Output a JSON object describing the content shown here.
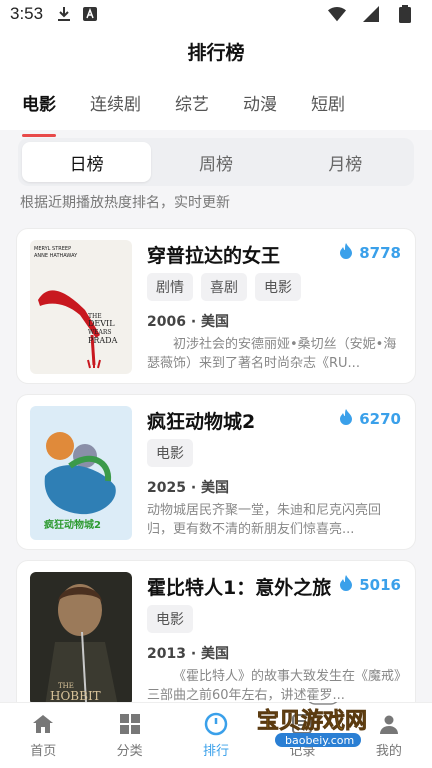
{
  "status": {
    "time": "3:53"
  },
  "header": {
    "title": "排行榜"
  },
  "category_tabs": [
    {
      "label": "电影",
      "active": true
    },
    {
      "label": "连续剧",
      "active": false
    },
    {
      "label": "综艺",
      "active": false
    },
    {
      "label": "动漫",
      "active": false
    },
    {
      "label": "短剧",
      "active": false
    }
  ],
  "period_tabs": [
    {
      "label": "日榜",
      "active": true
    },
    {
      "label": "周榜",
      "active": false
    },
    {
      "label": "月榜",
      "active": false
    }
  ],
  "hint": "根据近期播放热度排名，实时更新",
  "items": [
    {
      "title": "穿普拉达的女王",
      "heat": "8778",
      "tags": [
        "剧情",
        "喜剧",
        "电影"
      ],
      "meta": "2006 · 美国",
      "desc": "初涉社会的安德丽娅•桑切丝（安妮•海瑟薇饰）来到了著名时尚杂志《RU...",
      "poster_text": [
        "THE",
        "DEVIL",
        "WEARS",
        "PRADA"
      ]
    },
    {
      "title": "疯狂动物城2",
      "heat": "6270",
      "tags": [
        "电影"
      ],
      "meta": "2025 · 美国",
      "desc": "动物城居民齐聚一堂，朱迪和尼克闪亮回归，更有数不清的新朋友们惊喜亮...",
      "poster_text": [
        "疯狂动物城2"
      ]
    },
    {
      "title": "霍比特人1：意外之旅",
      "heat": "5016",
      "tags": [
        "电影"
      ],
      "meta": "2013 · 美国",
      "desc": "《霍比特人》的故事大致发生在《魔戒》三部曲之前60年左右，讲述霍罗...",
      "poster_text": [
        "THE",
        "HOBBIT"
      ]
    }
  ],
  "bottom_nav": [
    {
      "label": "首页",
      "icon": "home-icon",
      "active": false
    },
    {
      "label": "分类",
      "icon": "grid-icon",
      "active": false
    },
    {
      "label": "排行",
      "icon": "ranking-icon",
      "active": true
    },
    {
      "label": "记录",
      "icon": "history-icon",
      "active": false
    },
    {
      "label": "我的",
      "icon": "user-icon",
      "active": false
    }
  ],
  "watermark": {
    "text": "宝贝游戏网",
    "sub": "baobeiy.com"
  },
  "colors": {
    "accent": "#3aa0ea",
    "tab_indicator": "#e84a4a"
  }
}
